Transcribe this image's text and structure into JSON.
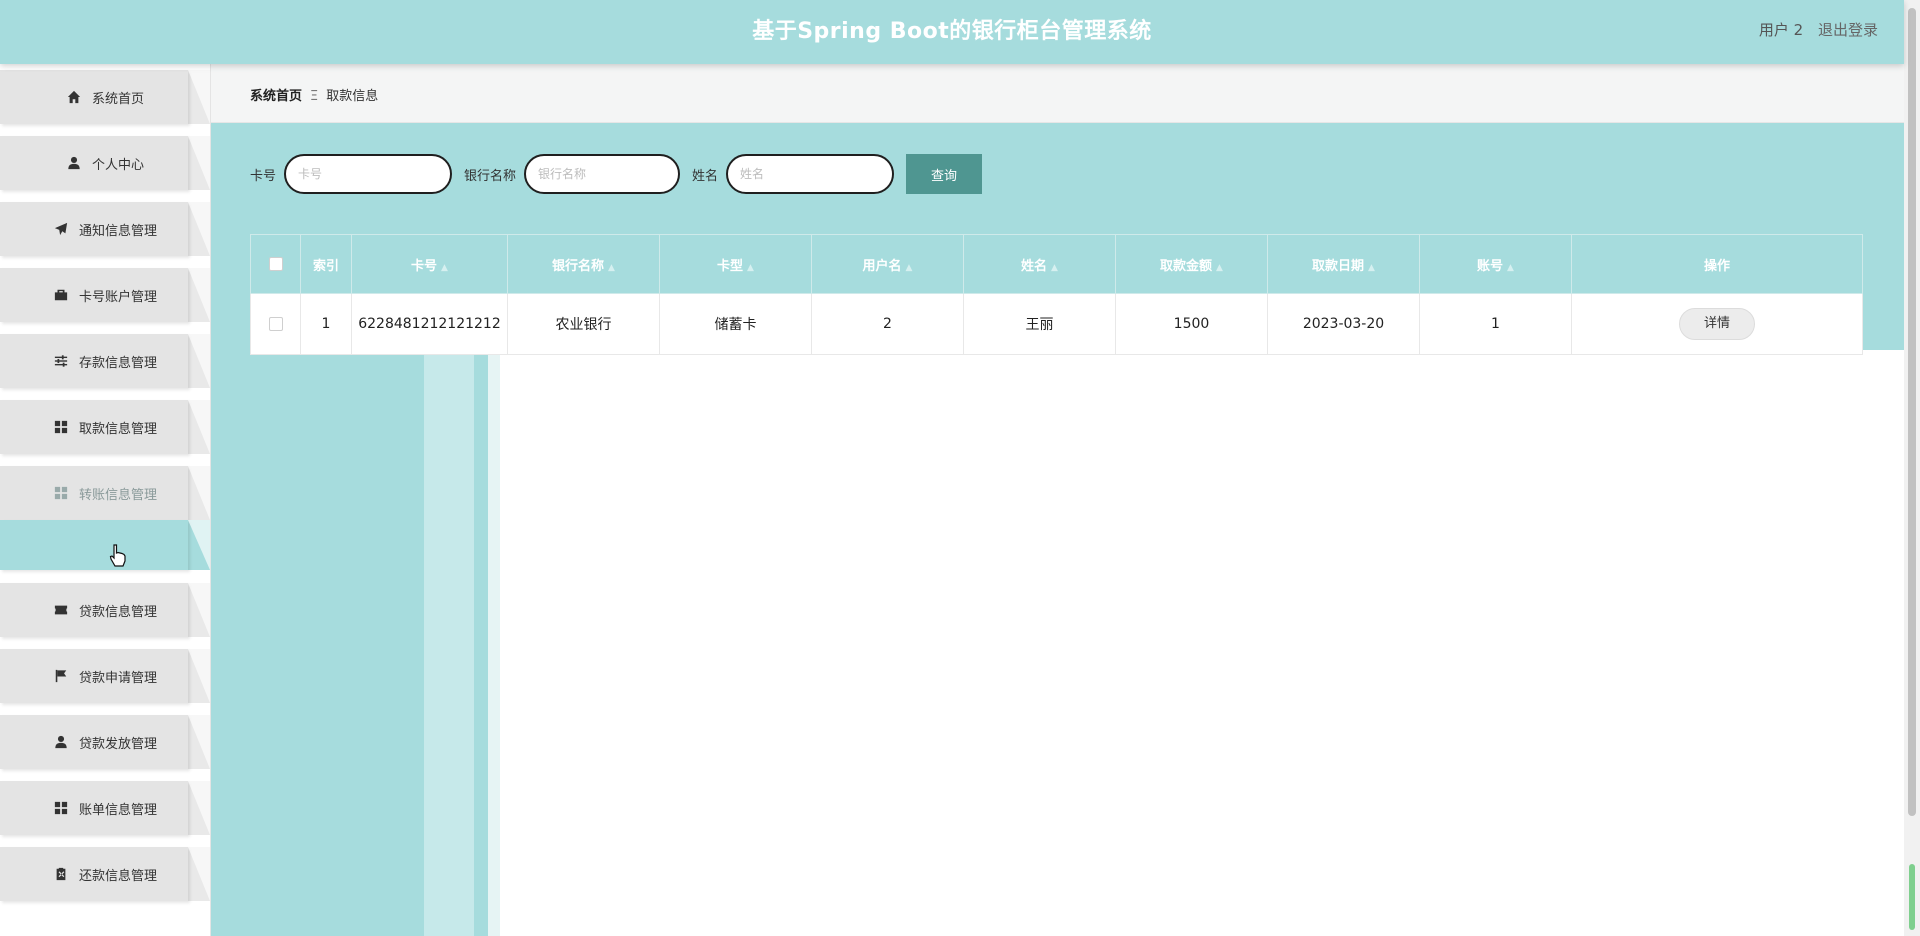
{
  "header": {
    "title": "基于Spring Boot的银行柜台管理系统",
    "user": "用户 2",
    "logout": "退出登录"
  },
  "sidebar": {
    "items": [
      {
        "label": "系统首页",
        "icon": "home-icon"
      },
      {
        "label": "个人中心",
        "icon": "user-icon"
      },
      {
        "label": "通知信息管理",
        "icon": "send-icon"
      },
      {
        "label": "卡号账户管理",
        "icon": "wallet-icon"
      },
      {
        "label": "存款信息管理",
        "icon": "sliders-icon"
      },
      {
        "label": "取款信息管理",
        "icon": "grid-icon"
      },
      {
        "label": "转账信息管理",
        "icon": "grid-icon"
      },
      {
        "label": "",
        "icon": ""
      },
      {
        "label": "贷款信息管理",
        "icon": "ticket-icon"
      },
      {
        "label": "贷款申请管理",
        "icon": "flag-icon"
      },
      {
        "label": "贷款发放管理",
        "icon": "user-icon"
      },
      {
        "label": "账单信息管理",
        "icon": "grid-icon"
      },
      {
        "label": "还款信息管理",
        "icon": "clipboard-icon"
      }
    ]
  },
  "breadcrumb": {
    "home": "系统首页",
    "separator": "Ξ",
    "current": "取款信息"
  },
  "search": {
    "card_label": "卡号",
    "card_placeholder": "卡号",
    "bank_label": "银行名称",
    "bank_placeholder": "银行名称",
    "name_label": "姓名",
    "name_placeholder": "姓名",
    "button": "查询"
  },
  "table": {
    "columns": [
      "索引",
      "卡号",
      "银行名称",
      "卡型",
      "用户名",
      "姓名",
      "取款金额",
      "取款日期",
      "账号",
      "操作"
    ],
    "rows": [
      {
        "index": "1",
        "card": "6228481212121212",
        "bank": "农业银行",
        "card_type": "储蓄卡",
        "username": "2",
        "name": "王丽",
        "amount": "1500",
        "date": "2023-03-20",
        "account": "1",
        "action": "详情"
      }
    ]
  },
  "colors": {
    "accent": "#a6dcdd",
    "button": "#4f9691"
  }
}
